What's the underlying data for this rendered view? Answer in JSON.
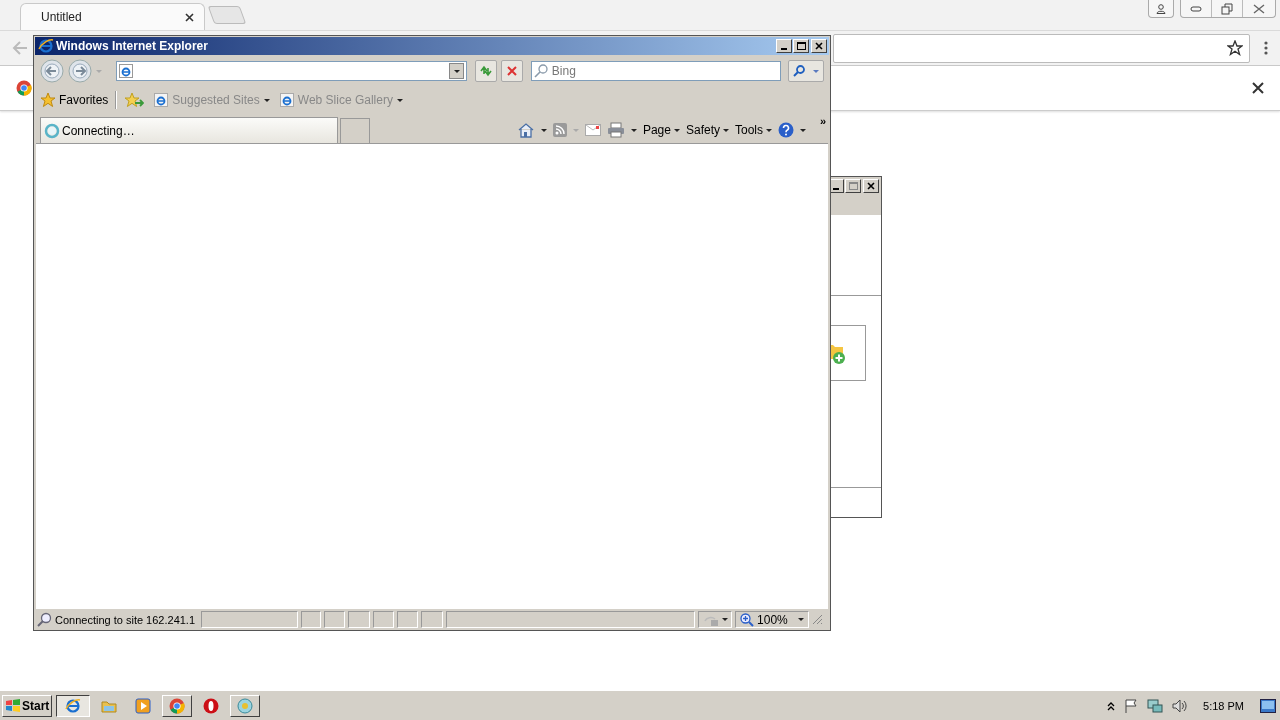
{
  "chrome": {
    "tabs": [
      {
        "title": "Untitled",
        "selected": true
      }
    ]
  },
  "ie": {
    "title": "Windows Internet Explorer",
    "search": {
      "placeholder": "Bing"
    },
    "favorites": {
      "label": "Favorites",
      "links": [
        {
          "label": "Suggested Sites"
        },
        {
          "label": "Web Slice Gallery"
        }
      ]
    },
    "tabs": [
      {
        "title": "Connecting…",
        "selected": true
      }
    ],
    "commands": [
      {
        "label": "Page"
      },
      {
        "label": "Safety"
      },
      {
        "label": "Tools"
      }
    ],
    "overflow": "»",
    "status_bar": {
      "text": "Connecting to site 162.241.1",
      "zoom": "100%"
    }
  },
  "taskbar": {
    "start": "Start",
    "buttons": [
      {
        "kind": "ie",
        "selected": true
      },
      {
        "kind": "folder",
        "selected": false
      },
      {
        "kind": "media",
        "selected": false
      },
      {
        "kind": "chrome",
        "selected": false
      },
      {
        "kind": "opera",
        "selected": false
      },
      {
        "kind": "app",
        "selected": false
      }
    ],
    "clock": "5:18 PM"
  }
}
